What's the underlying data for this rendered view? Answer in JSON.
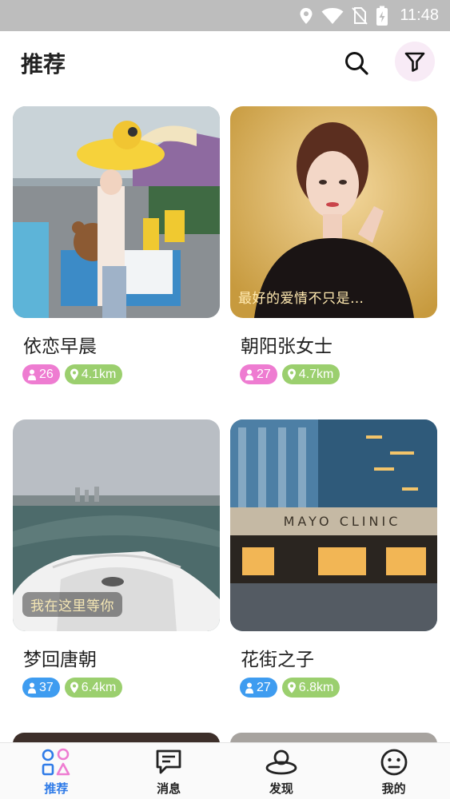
{
  "status_bar": {
    "time": "11:48",
    "icons": [
      "location-icon",
      "wifi-icon",
      "no-sim-icon",
      "battery-charging-icon"
    ]
  },
  "header": {
    "title": "推荐",
    "search_icon": "search-icon",
    "filter_icon": "filter-icon"
  },
  "cards": [
    {
      "name": "依恋早晨",
      "caption": "",
      "gender": "female",
      "age": "26",
      "distance": "4.1km"
    },
    {
      "name": "朝阳张女士",
      "caption": "最好的爱情不只是…",
      "gender": "female",
      "age": "27",
      "distance": "4.7km"
    },
    {
      "name": "梦回唐朝",
      "caption": "我在这里等你",
      "gender": "male",
      "age": "37",
      "distance": "6.4km"
    },
    {
      "name": "花街之子",
      "caption": "",
      "gender": "male",
      "age": "27",
      "distance": "6.8km"
    }
  ],
  "building_sign": "MAYO CLINIC",
  "colors": {
    "female_tag": "#ee7cd1",
    "male_tag": "#3e9cf0",
    "distance_tag": "#9bcf6e",
    "active_nav": "#2f7be8"
  },
  "bottom_nav": [
    {
      "label": "推荐",
      "icon": "shapes-icon",
      "active": true
    },
    {
      "label": "消息",
      "icon": "chat-icon",
      "active": false
    },
    {
      "label": "发现",
      "icon": "discover-icon",
      "active": false
    },
    {
      "label": "我的",
      "icon": "smiley-icon",
      "active": false
    }
  ]
}
